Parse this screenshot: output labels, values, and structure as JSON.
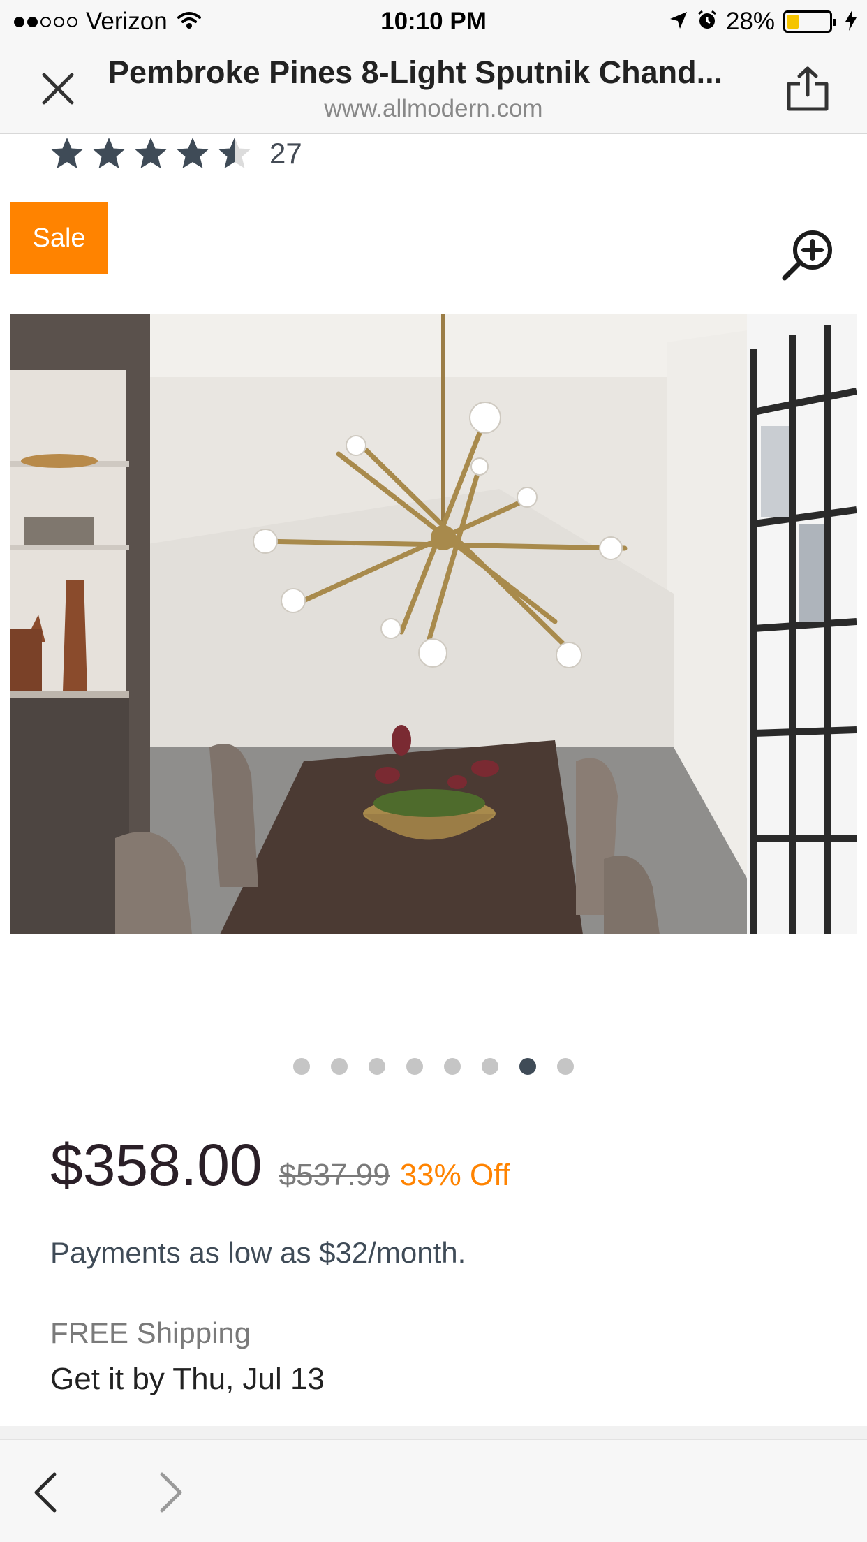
{
  "status_bar": {
    "carrier": "Verizon",
    "time": "10:10 PM",
    "battery_percent": "28%",
    "battery_level": 0.28,
    "signal_bars": 2,
    "icons": [
      "wifi-icon",
      "location-arrow-icon",
      "alarm-icon",
      "charging-bolt-icon"
    ]
  },
  "header": {
    "title": "Pembroke Pines 8-Light Sputnik Chand...",
    "url": "www.allmodern.com",
    "close_icon": "close-icon",
    "share_icon": "share-icon"
  },
  "rating": {
    "stars": 4.5,
    "review_count": "27"
  },
  "badge": {
    "sale_label": "Sale",
    "color": "#ff8300"
  },
  "gallery": {
    "zoom_icon": "zoom-in-icon",
    "image_alt": "Sputnik chandelier over a dining table",
    "total_images": 8,
    "active_index": 6
  },
  "pricing": {
    "price": "$358.00",
    "original_price": "$537.99",
    "discount": "33% Off",
    "accent_color": "#ff8300",
    "payments": "Payments as low as $32/month.",
    "shipping": "FREE Shipping",
    "delivery": "Get it by Thu, Jul 13"
  },
  "toolbar": {
    "back_icon": "back-chevron-icon",
    "forward_icon": "forward-chevron-icon"
  }
}
